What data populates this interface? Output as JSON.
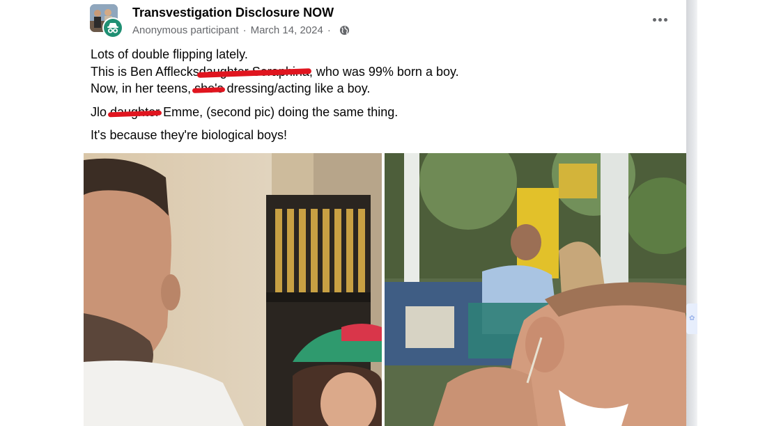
{
  "post": {
    "group_name": "Transvestigation Disclosure NOW",
    "author": "Anonymous participant",
    "separator": "·",
    "date": "March 14, 2024",
    "audience_icon": "globe-icon",
    "more_icon": "more-horizontal-icon",
    "lines": {
      "l1": "Lots of double flipping lately.",
      "l2_a": "This is Ben Afflecks",
      "l2_struck": "daughter Seraphina",
      "l2_b": ", who was 99% born a boy.",
      "l3_a": "Now, in her teens,",
      "l3_struck": "she's",
      "l3_b": " dressing/acting like a boy.",
      "l4_a": "Jlo ",
      "l4_struck": "daughter",
      "l4_b": " Emme,  (second pic) doing the same thing.",
      "l5": "It's because they're biological boys!"
    }
  },
  "photos": {
    "left": "photo-man-and-child",
    "right": "photo-woman-smiling-cafe"
  },
  "colors": {
    "strike": "#e0151f",
    "badge": "#1f8f73",
    "meta": "#65676b"
  }
}
